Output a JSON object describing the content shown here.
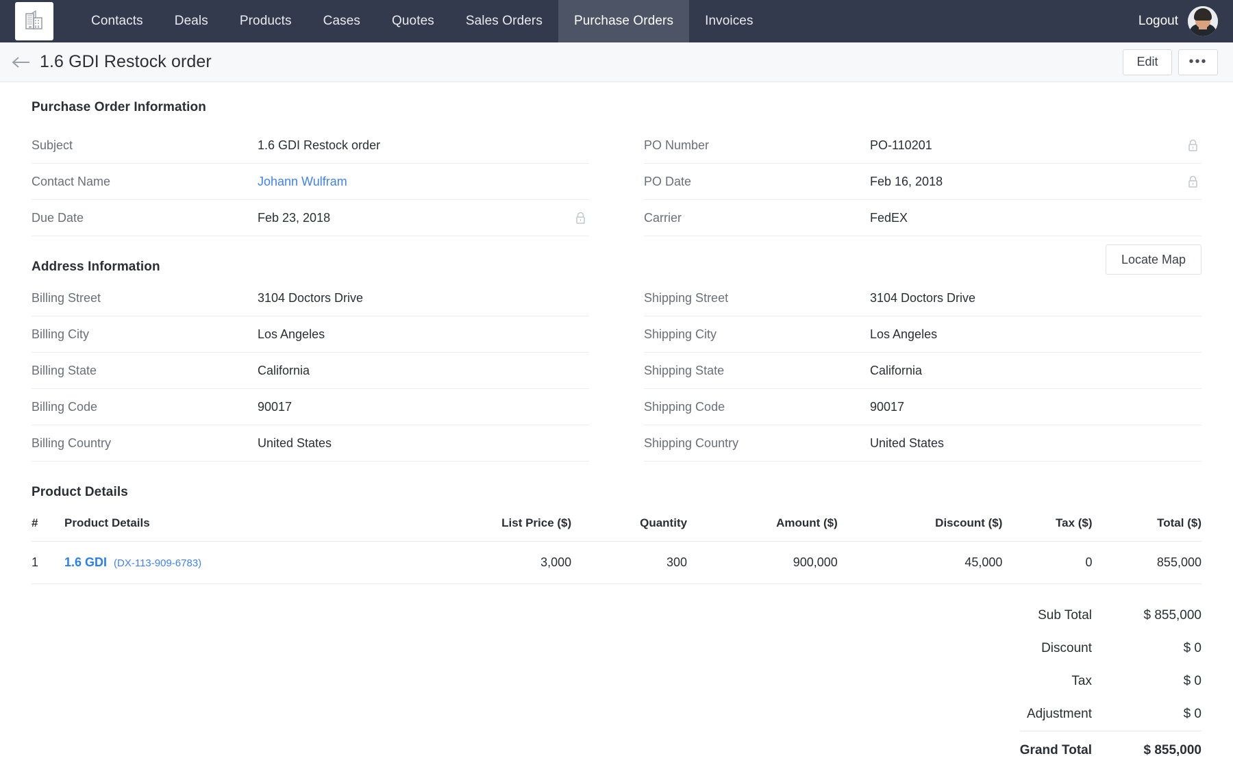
{
  "nav": {
    "logo_icon": "office-building-icon",
    "items": [
      {
        "label": "Contacts",
        "active": false
      },
      {
        "label": "Deals",
        "active": false
      },
      {
        "label": "Products",
        "active": false
      },
      {
        "label": "Cases",
        "active": false
      },
      {
        "label": "Quotes",
        "active": false
      },
      {
        "label": "Sales Orders",
        "active": false
      },
      {
        "label": "Purchase Orders",
        "active": true
      },
      {
        "label": "Invoices",
        "active": false
      }
    ],
    "logout_label": "Logout",
    "bg_color": "#343a4d",
    "active_bg_color": "#4c5466"
  },
  "titlebar": {
    "back_icon": "arrow-left-icon",
    "title": "1.6 GDI Restock order",
    "edit_label": "Edit",
    "more_label": "•••"
  },
  "po_info": {
    "section_title": "Purchase Order Information",
    "left_fields": [
      {
        "label": "Subject",
        "value": "1.6 GDI Restock order",
        "link": false,
        "locked": false
      },
      {
        "label": "Contact Name",
        "value": "Johann Wulfram",
        "link": true,
        "locked": false
      },
      {
        "label": "Due Date",
        "value": "Feb 23, 2018",
        "link": false,
        "locked": true
      }
    ],
    "right_fields": [
      {
        "label": "PO Number",
        "value": "PO-110201",
        "link": false,
        "locked": true
      },
      {
        "label": "PO Date",
        "value": "Feb 16, 2018",
        "link": false,
        "locked": true
      },
      {
        "label": "Carrier",
        "value": "FedEX",
        "link": false,
        "locked": false
      }
    ]
  },
  "address_info": {
    "section_title": "Address Information",
    "locate_map_label": "Locate Map",
    "billing_fields": [
      {
        "label": "Billing Street",
        "value": "3104 Doctors Drive"
      },
      {
        "label": "Billing City",
        "value": "Los Angeles"
      },
      {
        "label": "Billing State",
        "value": "California"
      },
      {
        "label": "Billing Code",
        "value": "90017"
      },
      {
        "label": "Billing Country",
        "value": "United States"
      }
    ],
    "shipping_fields": [
      {
        "label": "Shipping Street",
        "value": "3104 Doctors Drive"
      },
      {
        "label": "Shipping City",
        "value": "Los Angeles"
      },
      {
        "label": "Shipping State",
        "value": "California"
      },
      {
        "label": "Shipping Code",
        "value": "90017"
      },
      {
        "label": "Shipping Country",
        "value": "United States"
      }
    ]
  },
  "product_details": {
    "section_title": "Product Details",
    "columns": [
      "#",
      "Product Details",
      "List Price ($)",
      "Quantity",
      "Amount ($)",
      "Discount ($)",
      "Tax ($)",
      "Total ($)"
    ],
    "rows": [
      {
        "index": "1",
        "product_name": "1.6 GDI",
        "product_code": "(DX-113-909-6783)",
        "list_price": "3,000",
        "quantity": "300",
        "amount": "900,000",
        "discount": "45,000",
        "tax": "0",
        "total": "855,000"
      }
    ],
    "totals": [
      {
        "label": "Sub Total",
        "value": "$ 855,000",
        "grand": false
      },
      {
        "label": "Discount",
        "value": "$ 0",
        "grand": false
      },
      {
        "label": "Tax",
        "value": "$ 0",
        "grand": false
      },
      {
        "label": "Adjustment",
        "value": "$ 0",
        "grand": false
      },
      {
        "label": "Grand Total",
        "value": "$ 855,000",
        "grand": true
      }
    ]
  },
  "colors": {
    "link": "#3e82f7",
    "nav_bg": "#343a4d",
    "page_bg": "#ffffff",
    "titlebar_bg": "#f7f8f9"
  }
}
